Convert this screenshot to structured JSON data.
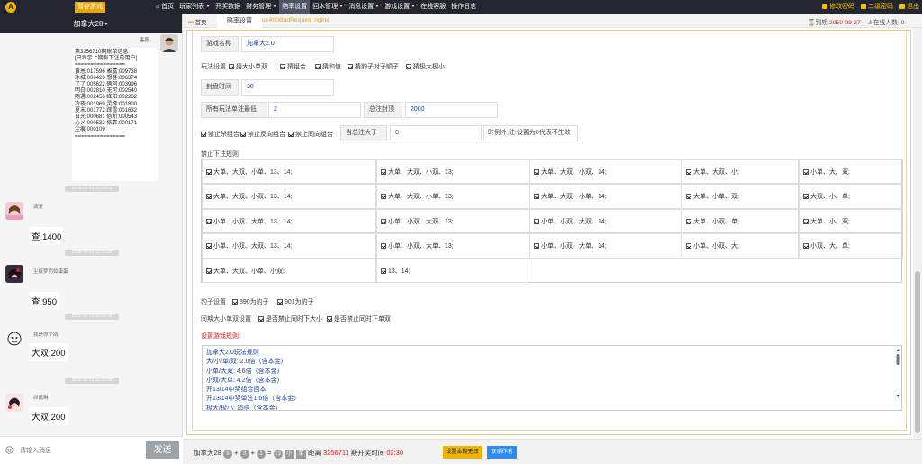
{
  "topbar": {
    "brand": "暂存游戏",
    "nav": [
      {
        "label": "首页",
        "icon": "home-icon"
      },
      {
        "label": "玩家列表",
        "dropdown": true
      },
      {
        "label": "开奖数据"
      },
      {
        "label": "财务管理",
        "dropdown": true
      },
      {
        "label": "赔率设置",
        "active": true
      },
      {
        "label": "回水管理",
        "dropdown": true
      },
      {
        "label": "消息设置",
        "dropdown": true
      },
      {
        "label": "游戏设置",
        "dropdown": true
      },
      {
        "label": "在线客服"
      },
      {
        "label": "操作日志"
      }
    ],
    "right": [
      {
        "label": "修改密码",
        "icon": "edit-icon"
      },
      {
        "label": "二级密码",
        "icon": "key-icon"
      },
      {
        "label": "退出",
        "icon": "logout-icon"
      }
    ]
  },
  "sidebar": {
    "game_name": "加拿大28",
    "messages": [
      {
        "user": "客服",
        "text": "第3256710期账单信息:\n[只显示上期有下注的用户]\n================\n黄恩:017596 雅嘉:009738\n冰城:006426 想甚:006374\n了了:005622 俩阿:003996\n明白:002810 无可:002540\n随遇:002456 峰阳:002262\n冷夜:001969 灵缘:001800\n夏末:001772 踩雪:001632\n日光:000681 俗新:000543\n心メ:000532 依靠:000171\n尘痕:000109\n================"
      },
      {
        "time": "2025-03-03 12:43:03",
        "user": "滴爱",
        "text": "查:1400"
      },
      {
        "time": "2025-03-03 12:43:05",
        "user": "尘痕梦而如蛋蛋",
        "text": "查:950"
      },
      {
        "time": "2025-03-03 12:43:16",
        "user": "我是你个鸽",
        "text": "大双:200"
      },
      {
        "time": "2025-03-03 12:43:06",
        "user": "卯酱琳",
        "text": "大双:200"
      }
    ],
    "input_placeholder": "请输入消息",
    "send_label": "发送"
  },
  "tabs": {
    "home": "首页",
    "active": "赔率设置",
    "status": "sr:400BadRequest nginx",
    "expiry_label": "到期:",
    "expiry_date": "2050-09-27",
    "online": "在线人数: 0"
  },
  "form": {
    "game_name_label": "游戏名称",
    "game_name_value": "加拿大2.0",
    "play_settings_label": "玩法设置",
    "play_options": [
      "猜大小单双",
      "猜组合",
      "猜和值",
      "猜豹子对子顺子",
      "猜极大极小"
    ],
    "close_time_label": "封盘时间",
    "close_time_value": "30",
    "min_bet_label": "所有玩法单注最低",
    "min_bet_value": "2",
    "max_total_label": "总注封顶",
    "max_total_value": "2000",
    "combo_options": [
      "禁止杀组合",
      "禁止反向组合",
      "禁止同向组合"
    ],
    "threshold_label": "当总注大于",
    "threshold_value": "0",
    "threshold_note": "时例外,注:设置为0代表不生效",
    "forbidden_title": "禁止下注规则",
    "forbidden_rules": [
      [
        "大单、大双、小单、13、14;",
        "大单、大双、小双、13;",
        "大单、大双、小双、14;",
        "大单、大双、小;",
        "小单、大、双;"
      ],
      [
        "大单、大双、小双、13、14;",
        "大单、大双、小单、13;",
        "大单、大双、小单、14;",
        "大单、小单、双;",
        "大双、小、单;"
      ],
      [
        "小单、小双、大单、13、14;",
        "小单、小双、大双、13;",
        "小单、小双、大双、14;",
        "大单、小双、单;",
        "大单、小、双;"
      ],
      [
        "小单、小双、大双、13、14;",
        "小单、小双、大单、13;",
        "小单、小双、大单、14;",
        "小单、小双、大;",
        "小双、大、单;"
      ],
      [
        "大单、大双、小单、小双;",
        "13、14;"
      ]
    ],
    "leopard_label": "豹子设置",
    "leopard_options": [
      "890为豹子",
      "901为豹子"
    ],
    "sync_label": "同期大小单双设置",
    "sync_options": [
      "是否禁止同时下大小",
      "是否禁止同时下单双"
    ],
    "rules_title": "设置游戏规则:",
    "rules_lines": [
      "加拿大2.0玩法规则",
      "大/小/单/双: 2.0倍（含本金）",
      "小单/大双: 4.6倍（含本金）",
      "小双/大单: 4.2倍（含本金）",
      "开13/14中奖组合回本",
      "开13/14中奖单注1.6倍（含本金）",
      "极大/极小: 15倍（含本金）"
    ]
  },
  "bottom": {
    "game": "加拿大28",
    "balls": [
      "9",
      "3",
      "1"
    ],
    "result": "13",
    "size": "小",
    "parity": "单",
    "distance_label": "距离",
    "period": "3256711",
    "open_label": "期开奖时间",
    "countdown": "02:30",
    "invalid_btn": "设置本期无效",
    "contact_btn": "联系作者"
  },
  "colors": {
    "topbar": "#23262e",
    "accent": "#e9a50c",
    "link_blue": "#2147a3",
    "danger": "#d22222",
    "invalid_btn": "#f0b400",
    "contact_btn": "#2d8cf0"
  }
}
